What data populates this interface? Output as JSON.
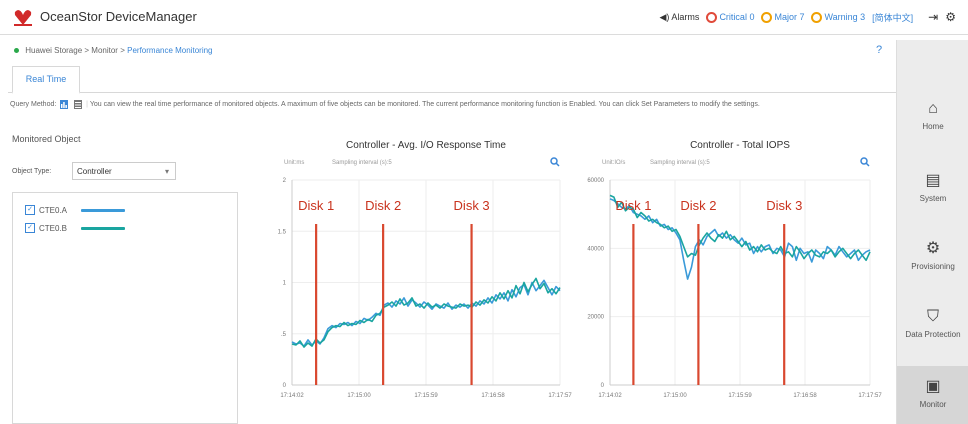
{
  "app": {
    "title": "OceanStor DeviceManager"
  },
  "topbar": {
    "alarms_label": "Alarms",
    "critical": "Critical 0",
    "major": "Major 7",
    "warning": "Warning 3",
    "lang": "[简体中文]"
  },
  "breadcrumb": {
    "items": [
      "Huawei Storage",
      "Monitor",
      "Performance Monitoring"
    ],
    "sep": ">"
  },
  "help": "?",
  "tabs": [
    {
      "label": "Real Time"
    }
  ],
  "query": {
    "label": "Query Method:",
    "text": "You can view the real time performance of monitored objects. A maximum of five objects can be monitored. The current performance monitoring function is Enabled. You can click Set Parameters to modify the settings."
  },
  "monitored": {
    "title": "Monitored Object",
    "object_type_label": "Object Type:",
    "object_type_value": "Controller",
    "items": [
      {
        "label": "CTE0.A",
        "color": "#3a9ad9",
        "checked": "✓"
      },
      {
        "label": "CTE0.B",
        "color": "#1aa5a0",
        "checked": "✓"
      }
    ]
  },
  "sidebar": {
    "items": [
      {
        "label": "Home",
        "icon": "home-icon"
      },
      {
        "label": "System",
        "icon": "system-icon"
      },
      {
        "label": "Provisioning",
        "icon": "provisioning-icon"
      },
      {
        "label": "Data Protection",
        "icon": "data-protection-icon"
      },
      {
        "label": "Monitor",
        "icon": "monitor-icon"
      }
    ]
  },
  "chart_data": [
    {
      "type": "line",
      "title": "Controller - Avg. I/O Response Time",
      "unit_label": "Unit:ms",
      "interval_label": "Sampling interval (s):5",
      "ylim": [
        0,
        2
      ],
      "yticks": [
        "0",
        ".5",
        "1",
        "1.5",
        "2"
      ],
      "xticks": [
        "17:14:02",
        "17:15:00",
        "17:15:59",
        "17:16:58",
        "17:17:57"
      ],
      "grid": true,
      "annotations": [
        {
          "label": "Disk 1",
          "x": 0.09
        },
        {
          "label": "Disk 2",
          "x": 0.34
        },
        {
          "label": "Disk 3",
          "x": 0.67
        }
      ],
      "series": [
        {
          "name": "CTE0.A",
          "color": "#3a9ad9",
          "values": [
            0.42,
            0.4,
            0.41,
            0.38,
            0.44,
            0.39,
            0.43,
            0.4,
            0.46,
            0.55,
            0.58,
            0.56,
            0.6,
            0.59,
            0.61,
            0.58,
            0.62,
            0.6,
            0.65,
            0.63,
            0.66,
            0.7,
            0.68,
            0.78,
            0.8,
            0.76,
            0.82,
            0.79,
            0.85,
            0.77,
            0.83,
            0.8,
            0.76,
            0.81,
            0.78,
            0.74,
            0.79,
            0.77,
            0.75,
            0.8,
            0.74,
            0.78,
            0.76,
            0.79,
            0.75,
            0.8,
            0.77,
            0.82,
            0.79,
            0.85,
            0.8,
            0.88,
            0.84,
            0.9,
            0.82,
            0.93,
            0.86,
            0.95,
            0.98,
            0.88,
            1.0,
            0.92,
            0.97,
            1.02,
            0.95,
            0.88,
            0.96,
            0.92
          ]
        },
        {
          "name": "CTE0.B",
          "color": "#1aa5a0",
          "values": [
            0.4,
            0.39,
            0.43,
            0.37,
            0.41,
            0.38,
            0.45,
            0.41,
            0.44,
            0.52,
            0.56,
            0.58,
            0.57,
            0.61,
            0.58,
            0.6,
            0.59,
            0.63,
            0.61,
            0.64,
            0.62,
            0.68,
            0.7,
            0.76,
            0.78,
            0.81,
            0.77,
            0.84,
            0.78,
            0.8,
            0.85,
            0.77,
            0.79,
            0.75,
            0.8,
            0.76,
            0.78,
            0.75,
            0.79,
            0.77,
            0.76,
            0.75,
            0.79,
            0.77,
            0.78,
            0.76,
            0.81,
            0.78,
            0.83,
            0.8,
            0.86,
            0.82,
            0.9,
            0.84,
            0.92,
            0.85,
            0.97,
            0.89,
            1.0,
            0.91,
            0.98,
            1.04,
            0.94,
            0.99,
            0.9,
            0.94,
            0.89,
            0.95
          ]
        }
      ]
    },
    {
      "type": "line",
      "title": "Controller - Total IOPS",
      "unit_label": "Unit:IO/s",
      "interval_label": "Sampling interval (s):5",
      "ylim": [
        0,
        60000
      ],
      "yticks": [
        "0",
        "20000",
        "40000",
        "60000"
      ],
      "xticks": [
        "17:14:02",
        "17:15:00",
        "17:15:59",
        "17:16:58",
        "17:17:57"
      ],
      "grid": true,
      "annotations": [
        {
          "label": "Disk 1",
          "x": 0.09
        },
        {
          "label": "Disk 2",
          "x": 0.34
        },
        {
          "label": "Disk 3",
          "x": 0.67
        }
      ],
      "series": [
        {
          "name": "CTE0.A",
          "color": "#3a9ad9",
          "values": [
            54500,
            54000,
            53000,
            52000,
            51500,
            52500,
            50500,
            50000,
            49500,
            48500,
            49500,
            47500,
            48500,
            46500,
            47000,
            45500,
            46000,
            44500,
            42500,
            36500,
            31000,
            34500,
            40500,
            42500,
            41000,
            43500,
            44500,
            45500,
            43500,
            44500,
            43000,
            44000,
            42500,
            41500,
            43000,
            41000,
            41500,
            38500,
            40500,
            39000,
            40500,
            41000,
            38500,
            40000,
            39500,
            37500,
            41500,
            40500,
            36500,
            40000,
            38500,
            39000,
            36000,
            39500,
            38500,
            37000,
            40500,
            39500,
            38000,
            40500,
            39000,
            37500,
            38500,
            39500,
            36500,
            38000,
            39000,
            39500
          ]
        },
        {
          "name": "CTE0.B",
          "color": "#1aa5a0",
          "values": [
            55500,
            55000,
            52000,
            53500,
            51000,
            52000,
            51500,
            49000,
            50500,
            49500,
            48000,
            48500,
            47500,
            47000,
            46000,
            46500,
            45000,
            45500,
            43500,
            40500,
            37500,
            38500,
            38000,
            41000,
            43000,
            44500,
            43000,
            42000,
            44000,
            43000,
            45000,
            42500,
            43500,
            42000,
            40500,
            42000,
            39500,
            40500,
            39000,
            41000,
            39500,
            40000,
            39000,
            38500,
            40500,
            38500,
            39000,
            37500,
            40500,
            39000,
            37000,
            38500,
            39500,
            38000,
            37500,
            39000,
            38500,
            39500,
            37500,
            39000,
            40000,
            38500,
            37000,
            38500,
            39500,
            38000,
            36500,
            39000
          ]
        }
      ]
    }
  ]
}
